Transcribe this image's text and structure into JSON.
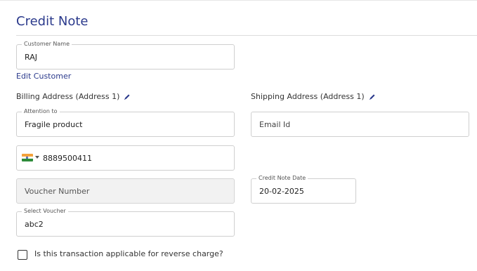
{
  "page": {
    "title": "Credit Note"
  },
  "customer": {
    "label": "Customer Name",
    "value": "RAJ",
    "edit_link": "Edit Customer"
  },
  "billing": {
    "section_label": "Billing Address (Address 1)",
    "attention_label": "Attention to",
    "attention_value": "Fragile product",
    "phone_country": "India",
    "phone_value": "8889500411"
  },
  "shipping": {
    "section_label": "Shipping Address (Address 1)",
    "email_placeholder": "Email Id"
  },
  "voucher": {
    "number_placeholder": "Voucher Number",
    "select_label": "Select Voucher",
    "select_value": "abc2"
  },
  "credit_note_date": {
    "label": "Credit Note Date",
    "value": "20-02-2025"
  },
  "reverse_charge": {
    "label": "Is this transaction applicable for reverse charge?",
    "checked": false
  },
  "colors": {
    "accent": "#2b3a8c",
    "border": "#cfcfcf",
    "disabled_bg": "#f2f2f2"
  }
}
